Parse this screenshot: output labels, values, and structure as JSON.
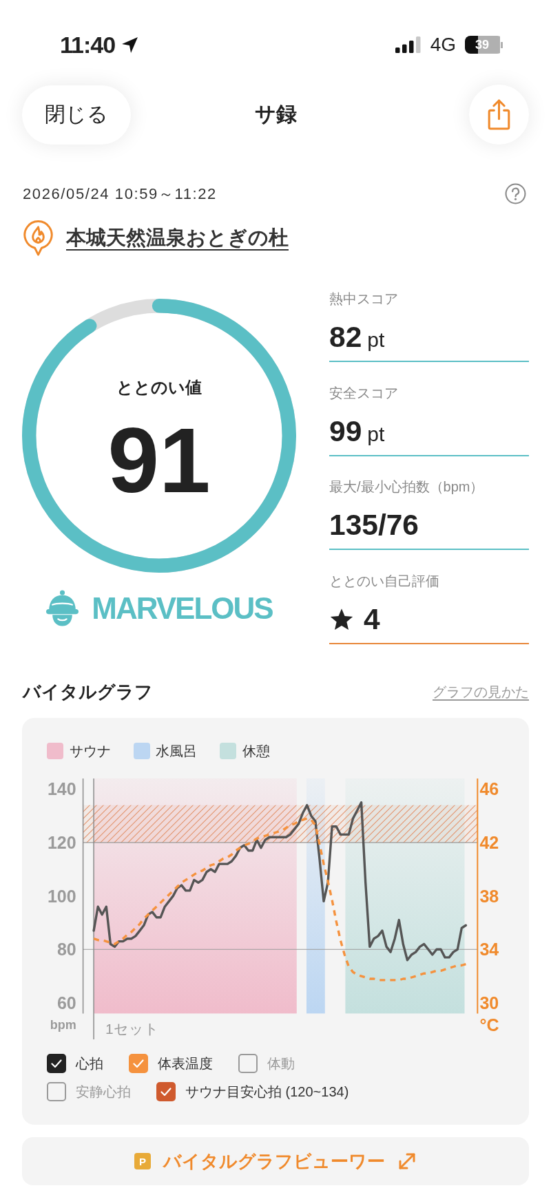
{
  "status_bar": {
    "time": "11:40",
    "network": "4G",
    "battery": "39"
  },
  "nav": {
    "close": "閉じる",
    "title": "サ録"
  },
  "session": {
    "datetime": "2026/05/24 10:59～11:22",
    "facility": "本城天然温泉おとぎの杜"
  },
  "score": {
    "label": "ととのい値",
    "value": "91",
    "level": 0.91,
    "rank": "MARVELOUS"
  },
  "stats": [
    {
      "kind": "score",
      "label": "熱中スコア",
      "value": "82",
      "unit": "pt"
    },
    {
      "kind": "score",
      "label": "安全スコア",
      "value": "99",
      "unit": "pt"
    },
    {
      "kind": "plain",
      "label": "最大/最小心拍数（bpm）",
      "value": "135/76"
    },
    {
      "kind": "rating",
      "label": "ととのい自己評価",
      "value": "4"
    }
  ],
  "vital_graph": {
    "title": "バイタルグラフ",
    "guide_link": "グラフの見かた",
    "legend": [
      {
        "label": "サウナ",
        "color": "#f0bccb"
      },
      {
        "label": "水風呂",
        "color": "#bcd6f2"
      },
      {
        "label": "休憩",
        "color": "#c4e0de"
      }
    ],
    "chart_data": {
      "type": "line",
      "xlabel": "1セット",
      "ylabel": "bpm",
      "ylim": [
        56,
        144
      ],
      "yticks": [
        60,
        80,
        100,
        120,
        140
      ],
      "y2label": "°C",
      "y2lim": [
        29.2,
        46.8
      ],
      "y2ticks": [
        30,
        34,
        38,
        42,
        46
      ],
      "series": [
        {
          "color": "#555555",
          "line_style": "solid",
          "values": [
            87,
            96,
            93,
            96,
            82,
            81,
            83,
            83,
            84,
            84,
            85,
            87,
            89,
            93,
            94,
            92,
            92,
            96,
            98,
            100,
            103,
            104,
            102,
            102,
            106,
            105,
            106,
            109,
            110,
            109,
            112,
            112,
            112,
            113,
            115,
            118,
            119,
            117,
            117,
            121,
            118,
            121,
            122,
            122,
            122,
            122,
            122,
            123,
            125,
            127,
            131,
            134,
            130,
            128,
            114,
            98,
            105,
            126,
            126,
            123,
            123,
            123,
            129,
            132,
            135,
            105,
            81,
            84,
            85,
            87,
            81,
            79,
            84,
            91,
            82,
            76,
            78,
            79,
            81,
            82,
            80,
            78,
            80,
            80,
            77,
            77,
            79,
            80,
            88,
            89
          ]
        },
        {
          "color": "#f5923e",
          "line_style": "dashed",
          "axis": "y2",
          "values": [
            34.8,
            34.7,
            34.7,
            34.6,
            34.5,
            34.4,
            34.6,
            34.8,
            35.1,
            35.3,
            35.6,
            35.9,
            36.3,
            36.6,
            36.9,
            37.2,
            37.5,
            37.8,
            38.1,
            38.4,
            38.7,
            39.0,
            39.2,
            39.4,
            39.6,
            39.8,
            39.9,
            40.1,
            40.3,
            40.4,
            40.6,
            40.8,
            40.9,
            41.1,
            41.4,
            41.6,
            41.8,
            41.9,
            42.1,
            42.3,
            42.4,
            42.5,
            42.6,
            42.7,
            42.8,
            42.9,
            43.1,
            43.3,
            43.4,
            43.6,
            43.7,
            43.8,
            43.7,
            43.3,
            41.9,
            40.4,
            39.1,
            37.7,
            36.1,
            34.7,
            33.6,
            32.7,
            32.3,
            32.1,
            32.0,
            31.9,
            31.8,
            31.8,
            31.7,
            31.7,
            31.7,
            31.7,
            31.7,
            31.7,
            31.8,
            31.8,
            31.9,
            32.0,
            32.1,
            32.2,
            32.2,
            32.3,
            32.4,
            32.4,
            32.5,
            32.6,
            32.7,
            32.8,
            32.8,
            32.9
          ]
        }
      ],
      "bands": [
        {
          "axis": "y",
          "from": 120,
          "to": 134,
          "color": "#e3936c"
        }
      ],
      "ref_lines": [
        {
          "axis": "y",
          "value": 120
        },
        {
          "axis": "y",
          "value": 80
        }
      ]
    },
    "toggle_rows": [
      [
        {
          "kind": "heart",
          "label": "心拍",
          "checked": true,
          "color": "#222222"
        },
        {
          "kind": "temperature",
          "label": "体表温度",
          "checked": true,
          "color": "#f5923e"
        },
        {
          "kind": "movement",
          "label": "体動",
          "checked": false
        }
      ],
      [
        {
          "kind": "resting",
          "label": "安静心拍",
          "checked": false
        },
        {
          "kind": "target",
          "label": "サウナ目安心拍 (120~134)",
          "checked": true,
          "color": "#cf5a2e"
        }
      ]
    ]
  },
  "viewer_button": {
    "badge": "P",
    "label": "バイタルグラフビューワー"
  }
}
